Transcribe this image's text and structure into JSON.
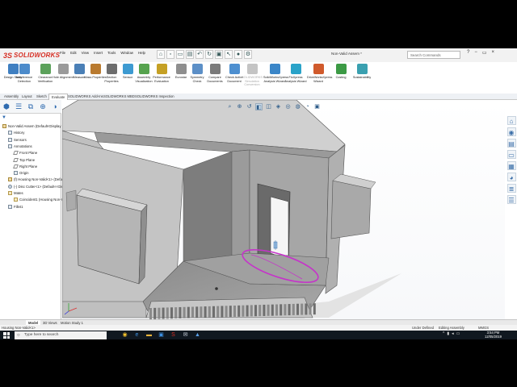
{
  "app": {
    "logo_ds": "3S",
    "logo_text": "SOLIDWORKS",
    "window_title": "Non-Valid Assem *",
    "brand_color": "#d62f24",
    "accent_color": "#2f6bb0"
  },
  "menu": [
    "File",
    "Edit",
    "View",
    "Insert",
    "Tools",
    "Window",
    "Help"
  ],
  "quick_access": [
    {
      "icon": "home-icon",
      "glyph": "⌂"
    },
    {
      "icon": "new-document-icon",
      "glyph": "▫"
    },
    {
      "icon": "open-folder-icon",
      "glyph": "▭"
    },
    {
      "icon": "print-icon",
      "glyph": "▤"
    },
    {
      "icon": "undo-icon",
      "glyph": "↶"
    },
    {
      "icon": "rebuild-icon",
      "glyph": "↻"
    },
    {
      "icon": "save-icon",
      "glyph": "▣"
    },
    {
      "icon": "select-arrow-icon",
      "glyph": "↖"
    },
    {
      "icon": "traffic-light-icon",
      "glyph": "●"
    },
    {
      "icon": "options-gear-icon",
      "glyph": "⚙"
    }
  ],
  "search": {
    "placeholder": "Search Commands"
  },
  "window_controls": [
    "?",
    "−",
    "▭",
    "×"
  ],
  "ribbon": [
    {
      "label": "Design Study",
      "color": "#3f7fc1",
      "enabled": true
    },
    {
      "label": "Interference Detection",
      "color": "#4c8bcb",
      "enabled": true
    },
    {
      "label": "Clearance Verification",
      "color": "#5ba15a",
      "enabled": true
    },
    {
      "label": "Hole Alignment",
      "color": "#9a9a9a",
      "enabled": true
    },
    {
      "label": "Measure",
      "color": "#4a7fb6",
      "enabled": true
    },
    {
      "label": "Mass Properties",
      "color": "#b97a2f",
      "enabled": true
    },
    {
      "label": "Section Properties",
      "color": "#6d6d6d",
      "enabled": true
    },
    {
      "label": "Sensor",
      "color": "#3d9ad1",
      "enabled": true
    },
    {
      "label": "Assembly Visualization",
      "color": "#56a34e",
      "enabled": true
    },
    {
      "label": "Performance Evaluation",
      "color": "#c5a024",
      "enabled": true
    },
    {
      "label": "Eurostar",
      "color": "#8e8e8e",
      "enabled": true
    },
    {
      "label": "Symmetry Check",
      "color": "#5c8fc7",
      "enabled": true
    },
    {
      "label": "Compare Documents",
      "color": "#7a7a7a",
      "enabled": true
    },
    {
      "label": "Check Active Document",
      "color": "#4d8fd0",
      "enabled": true
    },
    {
      "label": "SOLIDWORKS Simulation Conversion",
      "color": "#c4c4c4",
      "enabled": false
    },
    {
      "label": "SolidWorksXpress Analysis Wizard",
      "color": "#3a86c8",
      "enabled": true
    },
    {
      "label": "FloXpress Analysis Wizard",
      "color": "#2aa3c9",
      "enabled": true
    },
    {
      "label": "DriveWorksXpress Wizard",
      "color": "#d05a2c",
      "enabled": true
    },
    {
      "label": "Costing",
      "color": "#3c9a45",
      "enabled": true
    },
    {
      "label": "Sustainability",
      "color": "#3aa0b0",
      "enabled": true
    }
  ],
  "command_tabs": [
    "Assembly",
    "Layout",
    "Sketch",
    "Evaluate",
    "SOLIDWORKS Add-Ins",
    "SOLIDWORKS MBD",
    "SOLIDWORKS Inspection"
  ],
  "active_tab_index": 3,
  "feature_tree": [
    {
      "label": "Non-Valid Assem (Default<Display St",
      "indent": 0,
      "icon": "part"
    },
    {
      "label": "History",
      "indent": 1,
      "icon": "box"
    },
    {
      "label": "Sensors",
      "indent": 1,
      "icon": "box"
    },
    {
      "label": "Annotations",
      "indent": 1,
      "icon": "box"
    },
    {
      "label": "Front Plane",
      "indent": 2,
      "icon": "plane"
    },
    {
      "label": "Top Plane",
      "indent": 2,
      "icon": "plane"
    },
    {
      "label": "Right Plane",
      "indent": 2,
      "icon": "plane"
    },
    {
      "label": "Origin",
      "indent": 2,
      "icon": "box"
    },
    {
      "label": "(f) Housing Non-Valid<1> (Defaul",
      "indent": 1,
      "icon": "part"
    },
    {
      "label": "(-) Disc Cutter<1> (Default<<Def",
      "indent": 1,
      "icon": "cog"
    },
    {
      "label": "Mates",
      "indent": 1,
      "icon": "mate"
    },
    {
      "label": "Coincident1 (Housing Non-V",
      "indent": 2,
      "icon": "mate"
    },
    {
      "label": "Fillet1",
      "indent": 1,
      "icon": "box"
    }
  ],
  "heads_up_toolbar": [
    {
      "icon": "zoom-fit-icon",
      "glyph": "⌕",
      "active": false
    },
    {
      "icon": "zoom-area-icon",
      "glyph": "⊕",
      "active": false
    },
    {
      "icon": "previous-view-icon",
      "glyph": "↺",
      "active": false
    },
    {
      "icon": "section-view-icon",
      "glyph": "◧",
      "active": true
    },
    {
      "icon": "view-orientation-icon",
      "glyph": "◫",
      "active": false
    },
    {
      "icon": "display-style-icon",
      "glyph": "◈",
      "active": false
    },
    {
      "icon": "hide-show-icon",
      "glyph": "◎",
      "active": false
    },
    {
      "icon": "edit-appearance-icon",
      "glyph": "◍",
      "active": false
    },
    {
      "icon": "apply-scene-icon",
      "glyph": "◔",
      "active": false
    },
    {
      "icon": "view-settings-icon",
      "glyph": "▣",
      "active": false
    }
  ],
  "task_pane": [
    {
      "icon": "home-icon",
      "glyph": "⌂"
    },
    {
      "icon": "resources-icon",
      "glyph": "◉"
    },
    {
      "icon": "design-library-icon",
      "glyph": "▤"
    },
    {
      "icon": "file-explorer-icon",
      "glyph": "▭"
    },
    {
      "icon": "view-palette-icon",
      "glyph": "▦"
    },
    {
      "icon": "appearances-icon",
      "glyph": "◕"
    },
    {
      "icon": "custom-properties-icon",
      "glyph": "≣"
    },
    {
      "icon": "forum-icon",
      "glyph": "☰"
    }
  ],
  "bottom_tabs": [
    "Model",
    "3D Views",
    "Motion Study 1"
  ],
  "status": {
    "left": "Housing Non-Valid<1>",
    "defined": "Under Defined",
    "editing": "Editing Assembly",
    "units": "MMGS"
  },
  "taskbar": {
    "search_placeholder": "Type here to search",
    "apps": [
      {
        "icon": "chrome-icon",
        "glyph": "◉",
        "color": "#f2c12e"
      },
      {
        "icon": "edge-icon",
        "glyph": "e",
        "color": "#3c8fe0"
      },
      {
        "icon": "file-explorer-taskbar-icon",
        "glyph": "▬",
        "color": "#e8b43a"
      },
      {
        "icon": "store-icon",
        "glyph": "▣",
        "color": "#3c8fe0"
      },
      {
        "icon": "solidworks-taskbar-icon",
        "glyph": "S",
        "color": "#d62f24"
      },
      {
        "icon": "mail-icon",
        "glyph": "✉",
        "color": "#cfd8e3"
      },
      {
        "icon": "photos-icon",
        "glyph": "▲",
        "color": "#5aa0e8"
      }
    ],
    "time": "3:54 PM",
    "date": "12/05/2019"
  }
}
